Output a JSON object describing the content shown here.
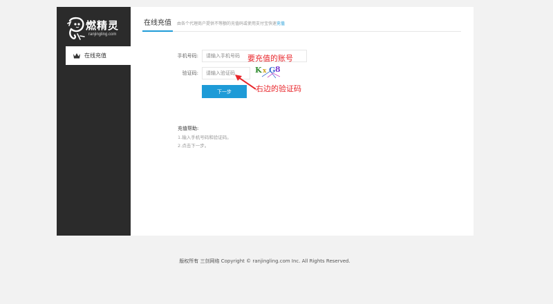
{
  "brand": {
    "name": "燃精灵",
    "domain": "ranjingling.com"
  },
  "sidebar": {
    "items": [
      {
        "label": "在线充值",
        "icon": "crown-icon",
        "active": true
      }
    ]
  },
  "tabs": {
    "active_label": "在线充值",
    "description": "由各个代理商户提供不等额的充值码或使用支付宝快速",
    "description_link": "充值"
  },
  "form": {
    "phone_label": "手机号码:",
    "phone_placeholder": "请输入手机号码",
    "captcha_label": "验证码:",
    "captcha_placeholder": "请输入验证码",
    "captcha_chars": [
      "K",
      "x",
      "G",
      "8"
    ],
    "next_button": "下一步"
  },
  "annotations": {
    "account_note": "要充值的账号",
    "captcha_note": "右边的验证码"
  },
  "help": {
    "title": "充值帮助:",
    "lines": [
      "1.输入手机号码和验证码。",
      "2.点击下一步。"
    ]
  },
  "footer": {
    "copyright": "版权所有 三剑网络 Copyright © ranjingling.com Inc. All Rights Reserved."
  },
  "colors": {
    "accent": "#1e9bd7",
    "sidebar_bg": "#2b2b2b",
    "annotation": "#e8262b"
  }
}
